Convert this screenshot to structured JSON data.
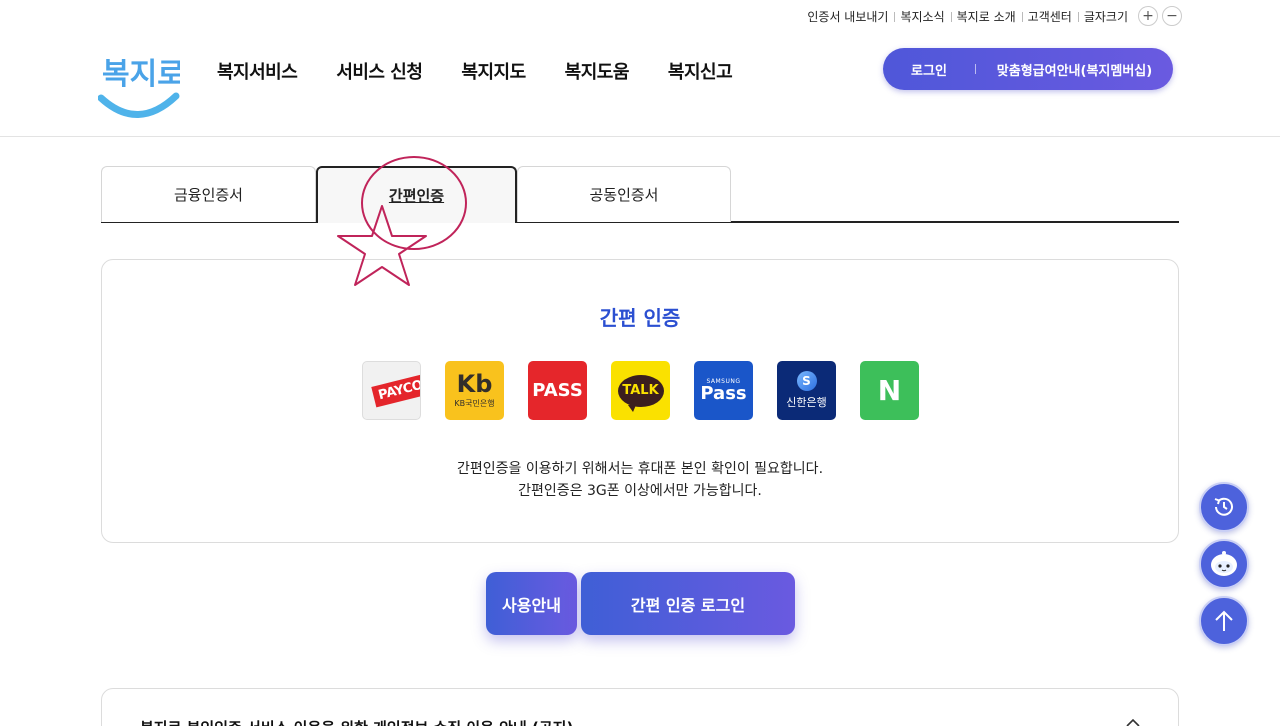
{
  "utility_bar": {
    "links": [
      "인증서 내보내기",
      "복지소식",
      "복지로 소개",
      "고객센터",
      "글자크기"
    ],
    "font_plus": "+",
    "font_minus": "−"
  },
  "header": {
    "logo_text": "복지로",
    "nav": [
      "복지서비스",
      "서비스 신청",
      "복지지도",
      "복지도움",
      "복지신고"
    ],
    "login_label": "로그인",
    "membership_label": "맞춤형급여안내(복지멤버십)"
  },
  "tabs": [
    {
      "label": "금융인증서",
      "active": false
    },
    {
      "label": "간편인증",
      "active": true
    },
    {
      "label": "공동인증서",
      "active": false
    }
  ],
  "card": {
    "title": "간편 인증",
    "apps": [
      {
        "name": "payco-icon",
        "text": "PAYCO"
      },
      {
        "name": "kb-bank-icon",
        "mark": "Kb",
        "text": "KB국민은행"
      },
      {
        "name": "pass-icon",
        "text": "PASS"
      },
      {
        "name": "kakao-talk-icon",
        "text": "TALK"
      },
      {
        "name": "samsung-pass-icon",
        "top": "SAMSUNG",
        "text": "Pass"
      },
      {
        "name": "shinhan-bank-icon",
        "mark": "S",
        "text": "신한은행"
      },
      {
        "name": "naver-icon",
        "text": "N"
      }
    ],
    "desc_line1": "간편인증을 이용하기 위해서는 휴대폰 본인 확인이 필요합니다.",
    "desc_line2": "간편인증은 3G폰 이상에서만 가능합니다."
  },
  "buttons": {
    "guide": "사용안내",
    "login": "간편 인증 로그인"
  },
  "accordion": {
    "title": "복지로 본인인증 서비스 이용을 위한 개인정보 수집 이용 안내 (공지)"
  },
  "colors": {
    "accent": "#4f57d9",
    "title_blue": "#2b4fd1",
    "annotation": "#c0245a"
  }
}
